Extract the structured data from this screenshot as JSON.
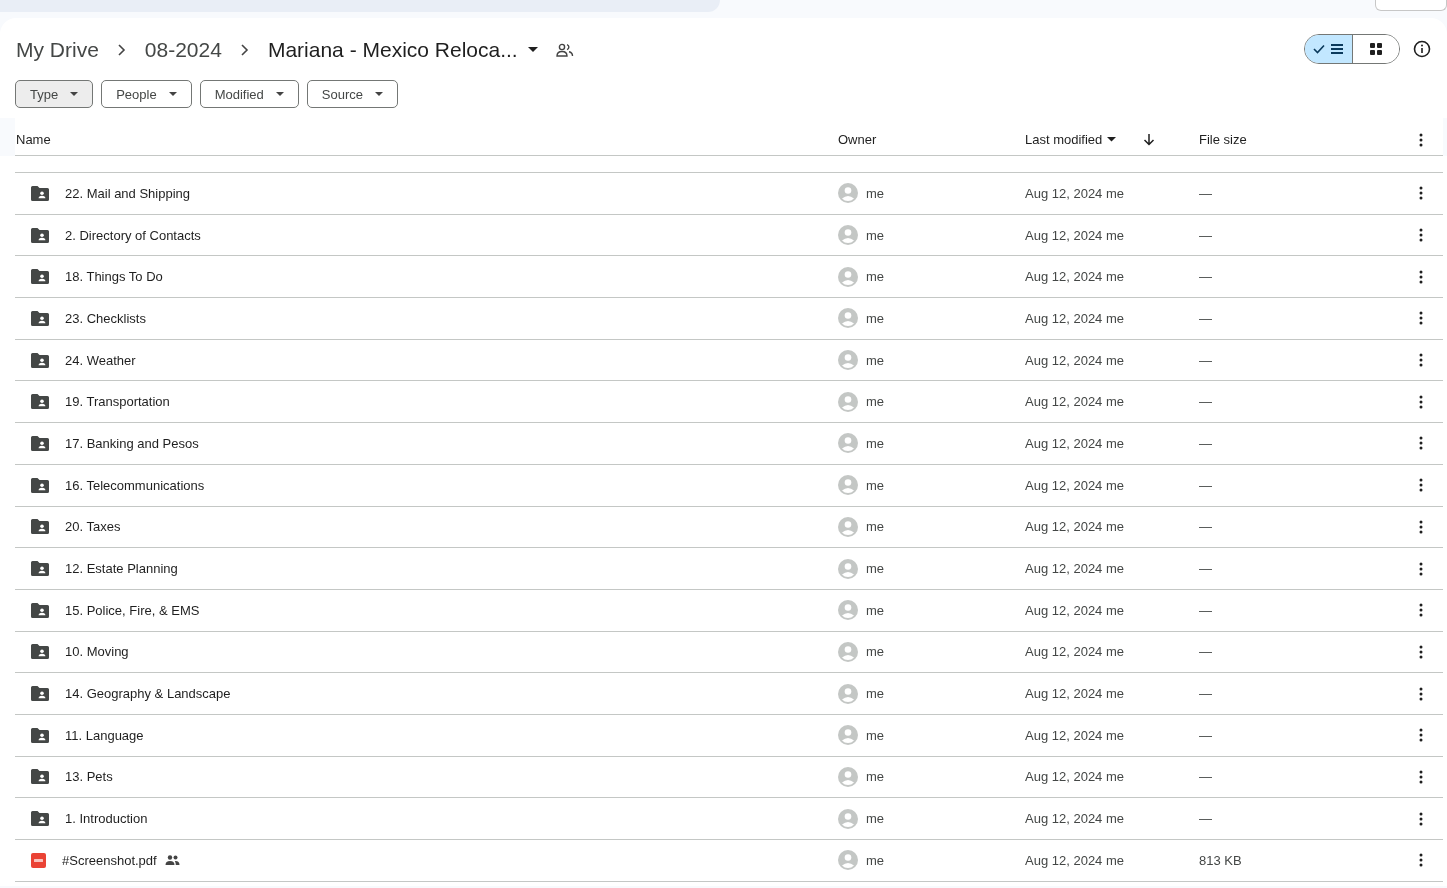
{
  "breadcrumb": [
    {
      "label": "My Drive",
      "current": false
    },
    {
      "label": "08-2024",
      "current": false
    },
    {
      "label": "Mariana - Mexico Reloca...",
      "current": true
    }
  ],
  "view_toggle": [
    {
      "kind": "list",
      "selected": true
    },
    {
      "kind": "grid",
      "selected": false
    }
  ],
  "filters": [
    {
      "label": "Type",
      "selected": true
    },
    {
      "label": "People",
      "selected": false
    },
    {
      "label": "Modified",
      "selected": false
    },
    {
      "label": "Source",
      "selected": false
    }
  ],
  "table": {
    "columns": [
      "Name",
      "Owner",
      "Last modified",
      "File size"
    ],
    "rows": [
      {
        "kind": "folder",
        "name": "22. Mail and Shipping",
        "shared": false,
        "owner": "me",
        "modified": "Aug 12, 2024 me",
        "size": "—"
      },
      {
        "kind": "folder",
        "name": "2. Directory of Contacts",
        "shared": false,
        "owner": "me",
        "modified": "Aug 12, 2024 me",
        "size": "—"
      },
      {
        "kind": "folder",
        "name": "18. Things To Do",
        "shared": false,
        "owner": "me",
        "modified": "Aug 12, 2024 me",
        "size": "—"
      },
      {
        "kind": "folder",
        "name": "23. Checklists",
        "shared": false,
        "owner": "me",
        "modified": "Aug 12, 2024 me",
        "size": "—"
      },
      {
        "kind": "folder",
        "name": "24. Weather",
        "shared": false,
        "owner": "me",
        "modified": "Aug 12, 2024 me",
        "size": "—"
      },
      {
        "kind": "folder",
        "name": "19. Transportation",
        "shared": false,
        "owner": "me",
        "modified": "Aug 12, 2024 me",
        "size": "—"
      },
      {
        "kind": "folder",
        "name": "17. Banking and Pesos",
        "shared": false,
        "owner": "me",
        "modified": "Aug 12, 2024 me",
        "size": "—"
      },
      {
        "kind": "folder",
        "name": "16. Telecommunications",
        "shared": false,
        "owner": "me",
        "modified": "Aug 12, 2024 me",
        "size": "—"
      },
      {
        "kind": "folder",
        "name": "20. Taxes",
        "shared": false,
        "owner": "me",
        "modified": "Aug 12, 2024 me",
        "size": "—"
      },
      {
        "kind": "folder",
        "name": "12. Estate Planning",
        "shared": false,
        "owner": "me",
        "modified": "Aug 12, 2024 me",
        "size": "—"
      },
      {
        "kind": "folder",
        "name": "15. Police, Fire, & EMS",
        "shared": false,
        "owner": "me",
        "modified": "Aug 12, 2024 me",
        "size": "—"
      },
      {
        "kind": "folder",
        "name": "10. Moving",
        "shared": false,
        "owner": "me",
        "modified": "Aug 12, 2024 me",
        "size": "—"
      },
      {
        "kind": "folder",
        "name": "14. Geography & Landscape",
        "shared": false,
        "owner": "me",
        "modified": "Aug 12, 2024 me",
        "size": "—"
      },
      {
        "kind": "folder",
        "name": "11. Language",
        "shared": false,
        "owner": "me",
        "modified": "Aug 12, 2024 me",
        "size": "—"
      },
      {
        "kind": "folder",
        "name": "13. Pets",
        "shared": false,
        "owner": "me",
        "modified": "Aug 12, 2024 me",
        "size": "—"
      },
      {
        "kind": "folder",
        "name": "1. Introduction",
        "shared": false,
        "owner": "me",
        "modified": "Aug 12, 2024 me",
        "size": "—"
      },
      {
        "kind": "pdf",
        "name": "#Screenshot.pdf",
        "shared": true,
        "owner": "me",
        "modified": "Aug 12, 2024 me",
        "size": "813 KB"
      }
    ]
  }
}
